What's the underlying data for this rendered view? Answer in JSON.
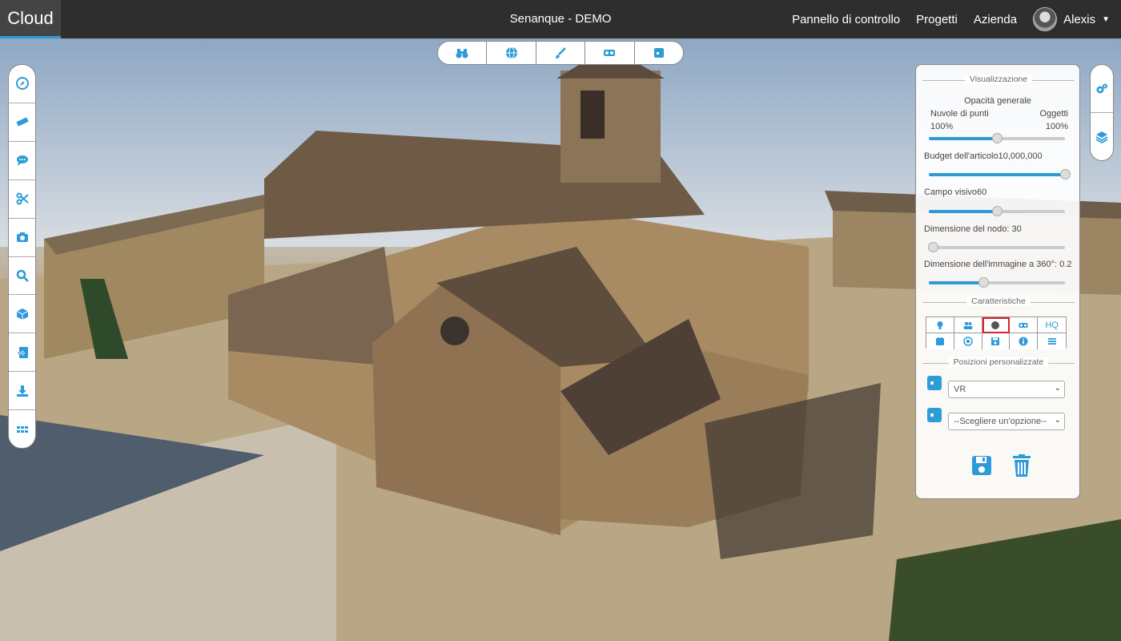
{
  "topbar": {
    "brand": "Cloud",
    "project_title": "Senanque - DEMO",
    "nav": [
      "Pannello di controllo",
      "Progetti",
      "Azienda"
    ],
    "user_name": "Alexis"
  },
  "top_toolbar": {
    "icons": [
      "binoculars-icon",
      "globe-icon",
      "brush-icon",
      "vr-headset-icon",
      "square-icon"
    ]
  },
  "left_toolbar": {
    "icons": [
      "compass-icon",
      "ruler-icon",
      "comment-icon",
      "scissors-icon",
      "camera-icon",
      "search-icon",
      "cube-icon",
      "import-icon",
      "download-icon",
      "grid-icon"
    ]
  },
  "right_toolbar": {
    "icons": [
      "gears-icon",
      "layers-icon"
    ]
  },
  "panel": {
    "visualization": {
      "title": "Visualizzazione",
      "opacity_title": "Opacità generale",
      "point_cloud_label": "Nuvole di punti",
      "point_cloud_value": "100%",
      "point_cloud_level": 0.5,
      "objects_label": "Oggetti",
      "objects_value": "100%",
      "budget_label": "Budget dell'articolo10,000,000",
      "budget_level": 1.0,
      "fov_label": "Campo visivo60",
      "fov_level": 0.5,
      "node_size_label": "Dimensione del nodo: 30",
      "node_size_level": 0.03,
      "image360_label": "Dimensione dell'immagine a 360°: 0.2",
      "image360_level": 0.4
    },
    "features": {
      "title": "Caratteristiche",
      "hq_label": "HQ",
      "icons": [
        "lightbulb-icon",
        "users-icon",
        "circle-icon",
        "vr-headset-icon",
        "hq-label",
        "box-icon",
        "record-icon",
        "floppy-icon",
        "info-icon",
        "menu-icon"
      ],
      "active_index": 2
    },
    "custom_positions": {
      "title": "Posizioni personalizzate",
      "select1_value": "VR",
      "select2_value": "--Scegliere un'opzione--"
    }
  },
  "colors": {
    "accent": "#2e9bd9",
    "navbar": "#2e2e2e",
    "active_outline": "#d8232a"
  }
}
